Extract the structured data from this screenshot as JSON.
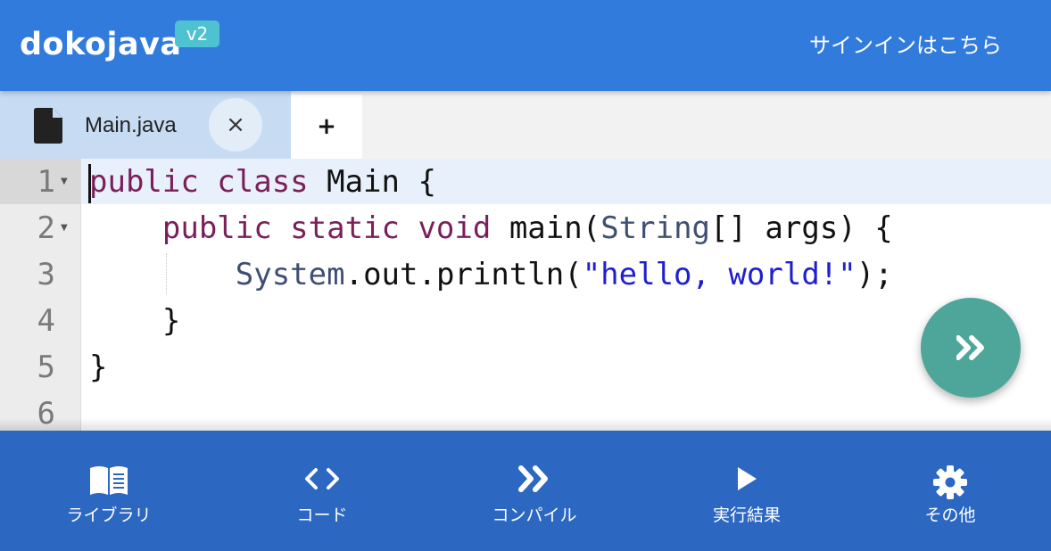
{
  "header": {
    "logo": "dokojava",
    "version_badge": "v2",
    "signin_label": "サインインはこちら"
  },
  "tabs": {
    "active_file": "Main.java",
    "close_symbol": "×",
    "add_symbol": "+"
  },
  "editor": {
    "line_numbers": [
      "1",
      "2",
      "3",
      "4",
      "5",
      "6"
    ],
    "code": {
      "line1": {
        "kw": "public class",
        "rest": " Main {"
      },
      "line2": {
        "indent": "    ",
        "kw": "public static void",
        "mid": " main(",
        "type": "String",
        "rest": "[] args) {"
      },
      "line3": {
        "indent": "        ",
        "type": "System",
        "mid": ".out.println(",
        "str": "\"hello, world!\"",
        "rest": ");"
      },
      "line4": {
        "text": "    }"
      },
      "line5": {
        "text": "}"
      }
    }
  },
  "fab": {
    "icon": "fast-forward-icon"
  },
  "bottom_nav": {
    "library": {
      "label": "ライブラリ",
      "icon": "book-icon"
    },
    "code": {
      "label": "コード",
      "icon": "code-icon"
    },
    "compile": {
      "label": "コンパイル",
      "icon": "double-chevron-icon"
    },
    "result": {
      "label": "実行結果",
      "icon": "play-icon"
    },
    "other": {
      "label": "その他",
      "icon": "gear-icon"
    }
  },
  "colors": {
    "header": "#317bdc",
    "bottom_nav": "#2c67c1",
    "fab": "#4ea69a",
    "badge": "#4fc2d2",
    "active_tab": "#c7dcf3"
  }
}
